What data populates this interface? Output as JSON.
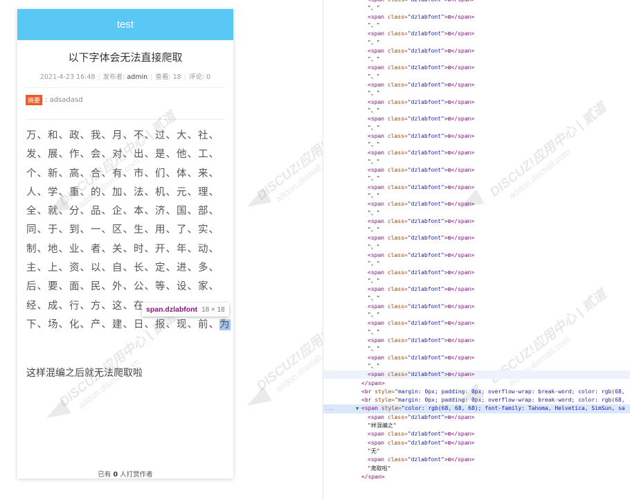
{
  "page": {
    "header_title": "test",
    "article_title": "以下字体会无法直接爬取",
    "meta": {
      "date": "2021-4-23 16:48",
      "publisher_label": "发布者:",
      "publisher": "admin",
      "views_label": "查看:",
      "views": "18",
      "comments_label": "评论:",
      "comments": "0"
    },
    "summary_tag": "摘要",
    "summary_text": ": adsadasd",
    "char_lines": [
      "万、和、政、我、月、不、过、大、社、",
      "发、展、作、会、对、出、是、他、工、",
      "个、新、高、合、有、市、们、体、来、",
      "人、学、重、的、加、法、机、元、理、",
      "全、就、分、品、企、本、济、国、部、",
      "同、于、到、一、区、生、用、了、实、",
      "制、地、业、者、关、时、开、年、动、",
      "主、上、资、以、自、长、定、进、多、",
      "后、要、面、民、外、公、等、设、家、",
      "经、成、行、方、这、在、",
      "下、场、化、产、建、日、报、现、前、"
    ],
    "highlighted_char": "为",
    "after_text": "这样混编之后就无法爬取啦",
    "reward_prefix": "已有",
    "reward_count": "0",
    "reward_suffix": "人打赏作者"
  },
  "tooltip": {
    "selector": "span.dzlabfont",
    "size": "18 × 18"
  },
  "devtools": {
    "span_open": "<span",
    "class_attr": "class=",
    "class_val": "\"dzlabfont\"",
    "glyph": ">⊠</span>",
    "sep_text": "\"、\"",
    "close_span": "</span>",
    "br_tag": "<br",
    "style_attr": "style=",
    "br_style_val": "\"margin: 0px; padding: 0px; overflow-wrap: break-word; color: rgb(68,",
    "span_style_val": "\"color: rgb(68, 68, 68); font-family: Tahoma, Helvetica, SimSun, sa",
    "text_1": "\"样混编之\"",
    "text_2": "\"无\"",
    "text_3": "\"爬取啦\"",
    "dots": "...",
    "expand_arrow": "▼"
  },
  "watermark": {
    "line1": "DISCUZ!应用中心 | 贰道",
    "line2": "addon.dismall.com"
  }
}
